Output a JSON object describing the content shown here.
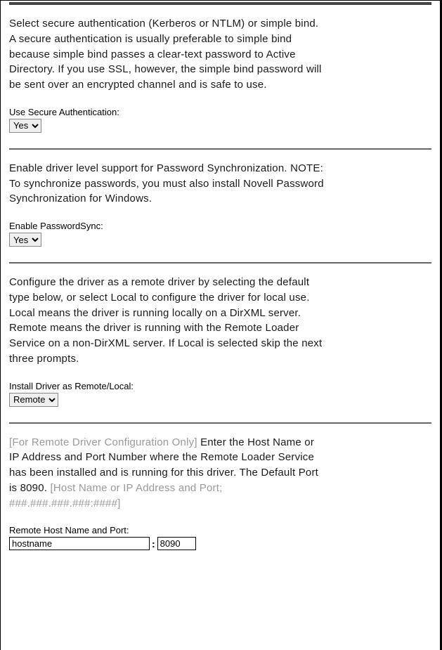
{
  "sections": {
    "auth": {
      "description": "Select secure authentication (Kerberos or NTLM) or simple bind. A secure authentication is usually preferable to simple bind because simple bind passes a clear-text password to Active Directory. If you use SSL, however, the simple bind password will be sent over an encrypted channel and is safe to use.",
      "label": "Use Secure Authentication:",
      "value": "Yes"
    },
    "passwordSync": {
      "description": "Enable driver level support for Password Synchronization. NOTE:  To synchronize passwords, you must also install Novell Password Synchronization for Windows.",
      "label": "Enable PasswordSync:",
      "value": "Yes"
    },
    "installDriver": {
      "description": "Configure the driver as a remote driver by selecting the default type below, or select Local to configure the driver for local use.  Local means the driver is running locally on a DirXML server.  Remote means the driver is running with the Remote Loader Service on a non-DirXML server.  If Local is selected skip the next three prompts.",
      "label": "Install Driver as Remote/Local:",
      "value": "Remote"
    },
    "remoteHost": {
      "notePrefix": "[For Remote Driver Configuration Only] ",
      "description": "Enter the Host Name or IP Address and Port Number where the Remote Loader Service has been installed and is running for this driver. The Default Port is 8090. ",
      "noteSuffixLabel": "[Host Name or IP Address and Port; ",
      "noteSuffixPattern": "###.###.###.###:####",
      "noteSuffixClose": "]",
      "label": "Remote Host Name and Port:",
      "hostValue": "hostname",
      "colon": ":",
      "portValue": "8090"
    }
  }
}
